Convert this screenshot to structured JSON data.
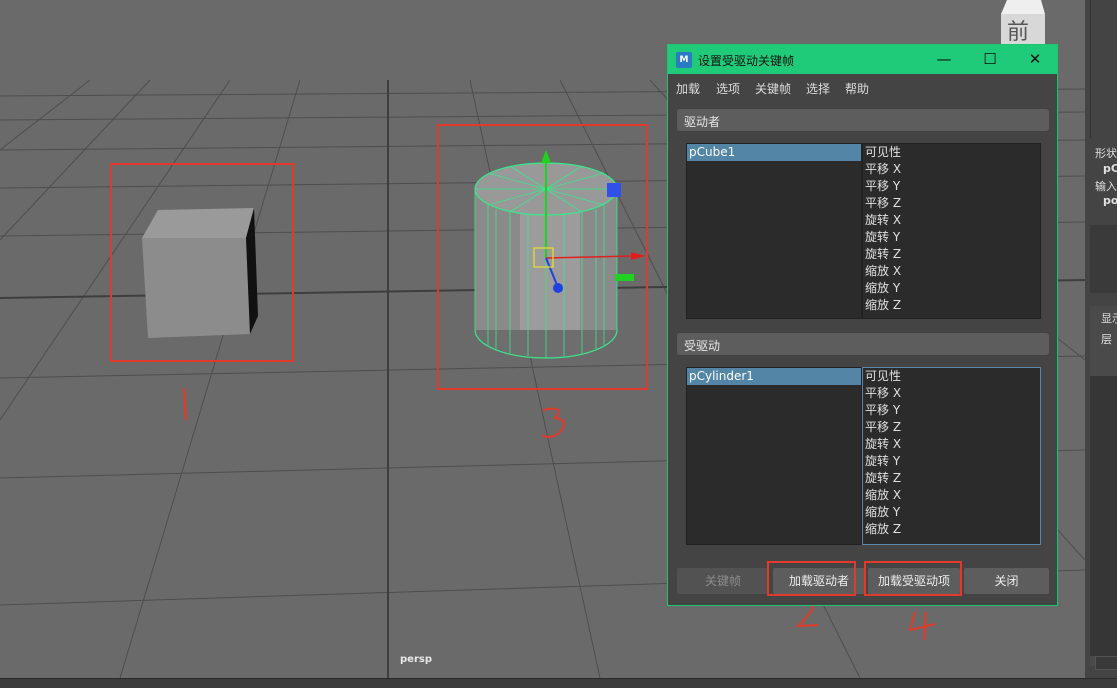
{
  "viewport": {
    "camera_label": "persp",
    "viewcube_label": "前",
    "annotations": [
      "1",
      "2",
      "3",
      "4"
    ]
  },
  "right_panel": {
    "lines": [
      "形状",
      "pC",
      "输入",
      "po",
      "显示",
      "层"
    ]
  },
  "dialog": {
    "title": "设置受驱动关键帧",
    "app_icon": "maya-icon",
    "window_controls": {
      "minimize": "—",
      "maximize": "☐",
      "close": "✕"
    },
    "menu": [
      "加载",
      "选项",
      "关键帧",
      "选择",
      "帮助"
    ],
    "driver": {
      "header": "驱动者",
      "objects": [
        "pCube1"
      ],
      "attributes": [
        "可见性",
        "平移 X",
        "平移 Y",
        "平移 Z",
        "旋转 X",
        "旋转 Y",
        "旋转 Z",
        "缩放 X",
        "缩放 Y",
        "缩放 Z"
      ]
    },
    "driven": {
      "header": "受驱动",
      "objects": [
        "pCylinder1"
      ],
      "attributes": [
        "可见性",
        "平移 X",
        "平移 Y",
        "平移 Z",
        "旋转 X",
        "旋转 Y",
        "旋转 Z",
        "缩放 X",
        "缩放 Y",
        "缩放 Z"
      ]
    },
    "buttons": {
      "key": "关键帧",
      "load_driver": "加载驱动者",
      "load_driven": "加载受驱动项",
      "close": "关闭"
    }
  },
  "colors": {
    "titlebar": "#1fcb78",
    "selection": "#5285a6",
    "annotation_red": "#e23a2a",
    "wireframe": "#39e88a"
  }
}
